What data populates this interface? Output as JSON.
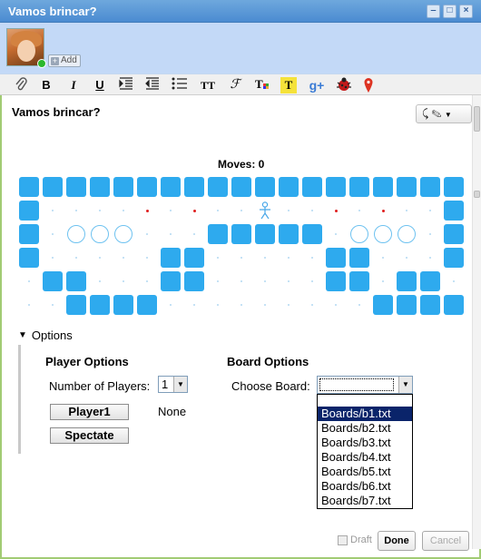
{
  "window": {
    "title": "Vamos brincar?"
  },
  "participants": {
    "add_label": "Add"
  },
  "toolbar": {
    "icons": [
      "attach-icon",
      "bold-icon",
      "italic-icon",
      "underline-icon",
      "indent-icon",
      "outdent-icon",
      "bullet-list-icon",
      "text-size-icon",
      "font-icon",
      "text-color-icon",
      "highlight-icon",
      "google-plus-icon",
      "bug-icon",
      "map-pin-icon"
    ],
    "bold": "B",
    "italic": "I",
    "underline": "U",
    "text_size": "TT",
    "highlight": "T",
    "gplus": "g+"
  },
  "wave": {
    "title": "Vamos brincar?"
  },
  "game": {
    "moves_label": "Moves: 0",
    "board": [
      "wwwwwwwwwwwwwwwwwww",
      "w....x.x..p..x.x..w",
      "w.ooo...wwwww.ooo.w",
      "w.....ww.....ww...w",
      ".ww...ww.....ww.ww.",
      "..wwww.........wwww"
    ]
  },
  "options": {
    "header": "Options",
    "player_options": {
      "title": "Player Options",
      "num_players_label": "Number of Players:",
      "num_players_value": "1",
      "player_button": "Player1",
      "player_status": "None",
      "spectate_button": "Spectate"
    },
    "board_options": {
      "title": "Board Options",
      "choose_label": "Choose Board:",
      "selected_value": "",
      "list": [
        "Boards/b1.txt",
        "Boards/b2.txt",
        "Boards/b3.txt",
        "Boards/b4.txt",
        "Boards/b5.txt",
        "Boards/b6.txt",
        "Boards/b7.txt"
      ],
      "highlighted": "Boards/b1.txt"
    }
  },
  "footer": {
    "draft": "Draft",
    "done": "Done",
    "cancel": "Cancel"
  },
  "colors": {
    "wall": "#2eaaee",
    "accent_border": "#a1cb73",
    "title_bar": "#4b8bd1"
  }
}
